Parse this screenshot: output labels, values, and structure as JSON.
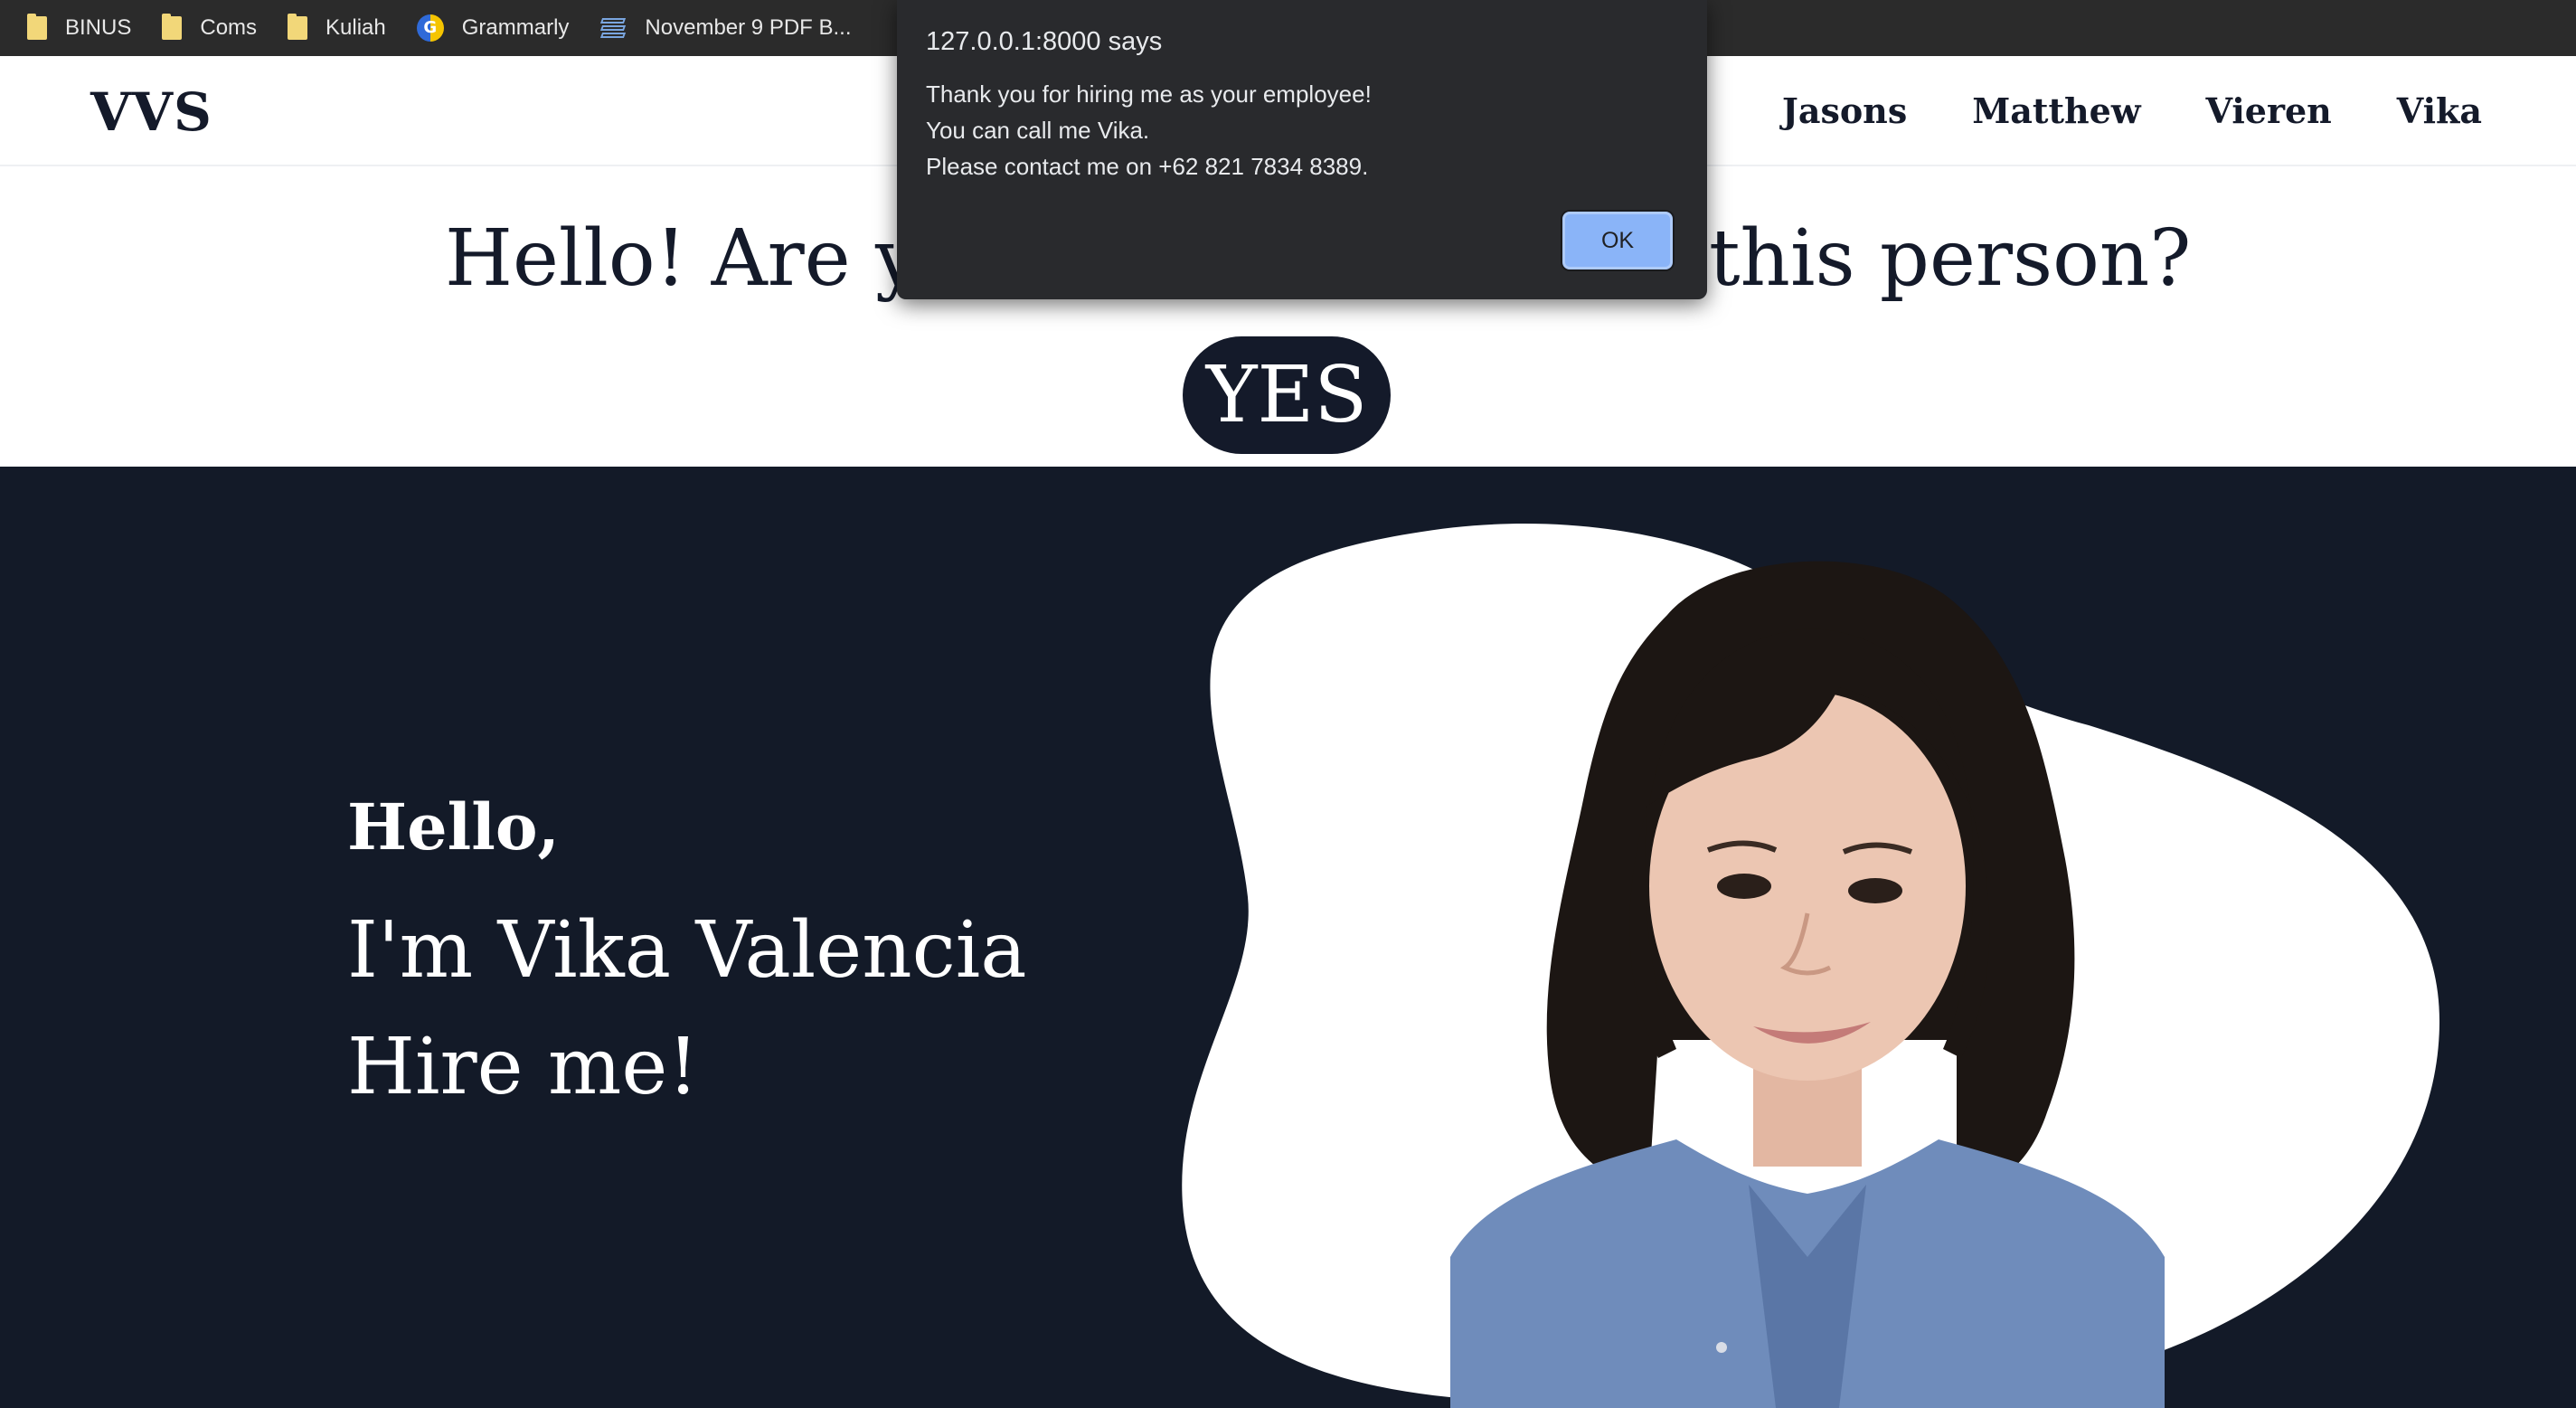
{
  "bookmarks": [
    {
      "label": "BINUS",
      "icon": "folder-icon"
    },
    {
      "label": "Coms",
      "icon": "folder-icon"
    },
    {
      "label": "Kuliah",
      "icon": "folder-icon"
    },
    {
      "label": "Grammarly",
      "icon": "grammarly-icon"
    },
    {
      "label": "November 9 PDF B...",
      "icon": "book-stack-icon"
    }
  ],
  "nav": {
    "logo": "VVS",
    "links": [
      "Jasons",
      "Matthew",
      "Vieren",
      "Vika"
    ]
  },
  "question": {
    "before_dialog": "Hello! Are yo",
    "after_dialog": "this person?",
    "button": "YES"
  },
  "hero": {
    "greeting": "Hello,",
    "name_line": "I'm Vika Valencia",
    "cta_line": "Hire me!"
  },
  "alert": {
    "title": "127.0.0.1:8000 says",
    "lines": [
      "Thank you for hiring me as your employee!",
      "You can call me Vika.",
      "Please contact me on +62 821 7834 8389."
    ],
    "ok_label": "OK"
  },
  "colors": {
    "navy": "#131a28",
    "text_dark": "#141a2a",
    "bookmark_bar": "#2b2b2b",
    "dialog_bg": "#292a2d",
    "ok_button": "#8ab4f8"
  }
}
